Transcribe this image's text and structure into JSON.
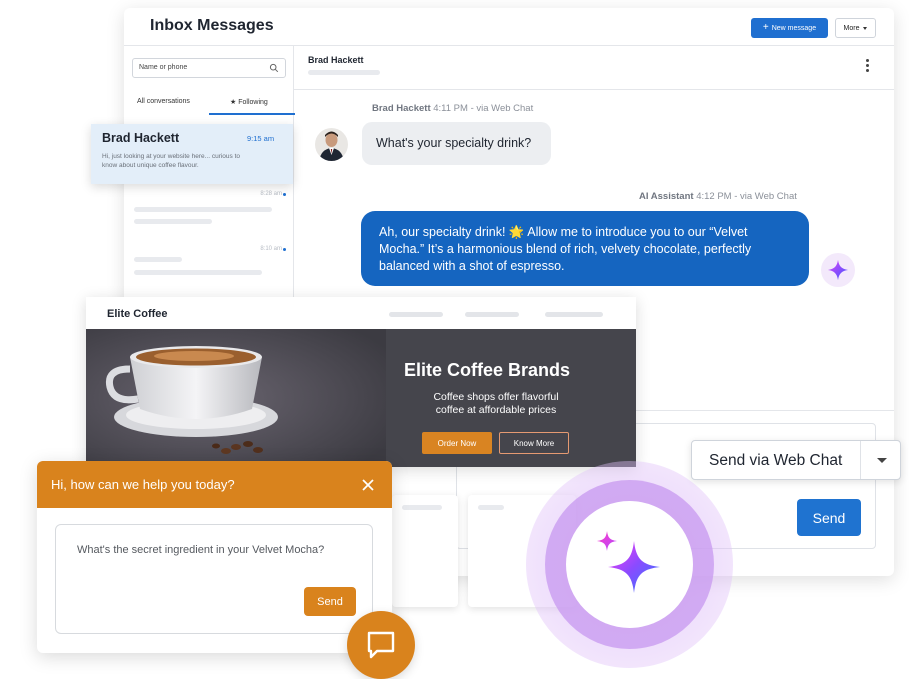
{
  "inbox": {
    "title": "Inbox Messages",
    "new_message_label": "New message",
    "more_label": "More",
    "search_placeholder": "Name or phone",
    "tabs": [
      "All conversations",
      "Following"
    ],
    "active_conversation": {
      "name": "Brad Hackett",
      "time": "9:15 am",
      "preview": "Hi, just looking at your website here... curious to know about unique coffee flavour."
    },
    "other_conversation_times": [
      "8:28 am",
      "8:10 am"
    ]
  },
  "chat": {
    "contact_name": "Brad Hackett",
    "messages": [
      {
        "sender": "Brad Hackett",
        "meta": "4:11 PM - via Web Chat",
        "text": "What's your specialty drink?"
      },
      {
        "sender": "AI Assistant",
        "meta": "4:12 PM - via Web Chat",
        "text": "Ah, our specialty drink! 🌟 Allow me to introduce you to our “Velvet Mocha.” It’s a harmonious blend of rich, velvety chocolate, perfectly balanced with a shot of espresso."
      }
    ],
    "send_via_label": "Send via Web Chat",
    "send_label": "Send"
  },
  "website": {
    "brand": "Elite Coffee",
    "hero_title": "Elite Coffee Brands",
    "hero_subtitle": "Coffee shops offer flavorful coffee at affordable prices",
    "order_label": "Order Now",
    "know_more_label": "Know More"
  },
  "widget": {
    "greeting": "Hi, how can we help you today?",
    "message": "What's the secret ingredient in your Velvet Mocha?",
    "send_label": "Send"
  },
  "colors": {
    "primary_blue": "#1f6fd0",
    "bubble_blue": "#1565c0",
    "accent_orange": "#d9831d",
    "ai_purple": "#c99cf0"
  },
  "icons": [
    "plus-icon",
    "caret-down-icon",
    "search-icon",
    "star-icon",
    "kebab-icon",
    "sparkle-icon",
    "close-icon",
    "chat-bubble-icon"
  ]
}
